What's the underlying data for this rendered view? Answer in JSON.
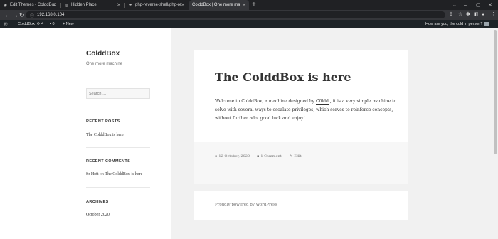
{
  "browser": {
    "tabs": [
      {
        "title": "Edit Themes ‹ ColddBox",
        "active": false
      },
      {
        "title": "Hidden Place",
        "active": false
      },
      {
        "title": "php-reverse-shell/php-re",
        "active": false
      },
      {
        "title": "ColddBox | One more ma",
        "active": true
      }
    ],
    "url": "192.168.0.104"
  },
  "adminbar": {
    "site": "ColddBox",
    "updates": "4",
    "comments": "0",
    "new": "New",
    "greeting": "How are you, the cold in person?"
  },
  "sidebar": {
    "site_title": "ColddBox",
    "site_description": "One more machine",
    "search_placeholder": "Search …",
    "recent_posts_title": "RECENT POSTS",
    "recent_post": "The ColddBox is here",
    "recent_comments_title": "RECENT COMMENTS",
    "comment_author": "Sr Hott",
    "comment_on": "on",
    "comment_post": "The ColddBox is here",
    "archives_title": "ARCHIVES",
    "archive": "October 2020"
  },
  "post": {
    "title": "The ColddBox is here",
    "body_pre": "Welcome to ColddBox, a machine designed by ",
    "body_link": "C0ldd",
    "body_post": " , it is a very simple machine to solve with several ways to escalate privileges, which serves to reinforce concepts, without further ado, good luck and enjoy!",
    "date": "12 October, 2020",
    "comments": "1 Comment",
    "edit": "Edit"
  },
  "footer": {
    "powered": "Proudly powered by WordPress"
  }
}
